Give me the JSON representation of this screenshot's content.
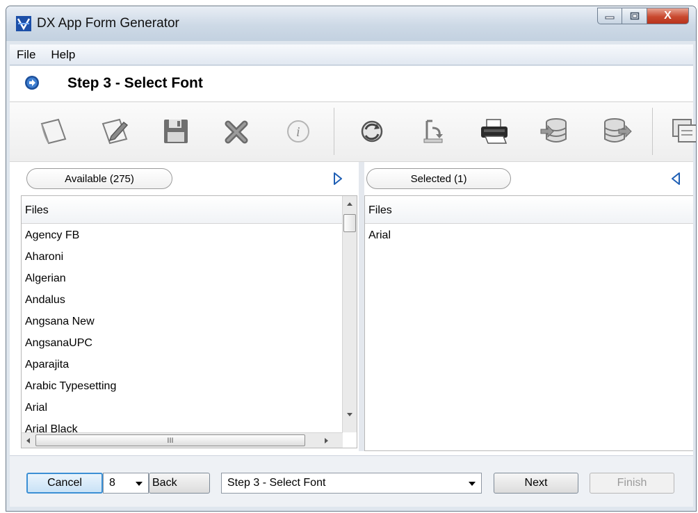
{
  "window": {
    "title": "DX App Form Generator",
    "close_glyph": "X"
  },
  "menu": [
    "File",
    "Help"
  ],
  "step": {
    "title": "Step 3 - Select Font"
  },
  "toolbar": {
    "group1": [
      "new-icon",
      "edit-icon",
      "save-icon",
      "delete-icon",
      "info-icon"
    ],
    "group2": [
      "refresh-icon",
      "import-icon",
      "print-icon",
      "database-export-icon",
      "database-import-icon",
      "window-copy-icon"
    ]
  },
  "available": {
    "label": "Available (275)",
    "column": "Files",
    "items": [
      "Agency FB",
      "Aharoni",
      "Algerian",
      "Andalus",
      "Angsana New",
      "AngsanaUPC",
      "Aparajita",
      "Arabic Typesetting",
      "Arial",
      "Arial Black"
    ],
    "hscroll_grip": "III"
  },
  "selected": {
    "label": "Selected (1)",
    "column": "Files",
    "items": [
      "Arial"
    ]
  },
  "footer": {
    "cancel_label": "Cancel",
    "page_value": "8",
    "back_label": "Back",
    "step_value": "Step 3 - Select Font",
    "next_label": "Next",
    "finish_label": "Finish"
  },
  "colors": {
    "accent": "#1a75c9",
    "disabled_text": "#9a9a9a"
  }
}
